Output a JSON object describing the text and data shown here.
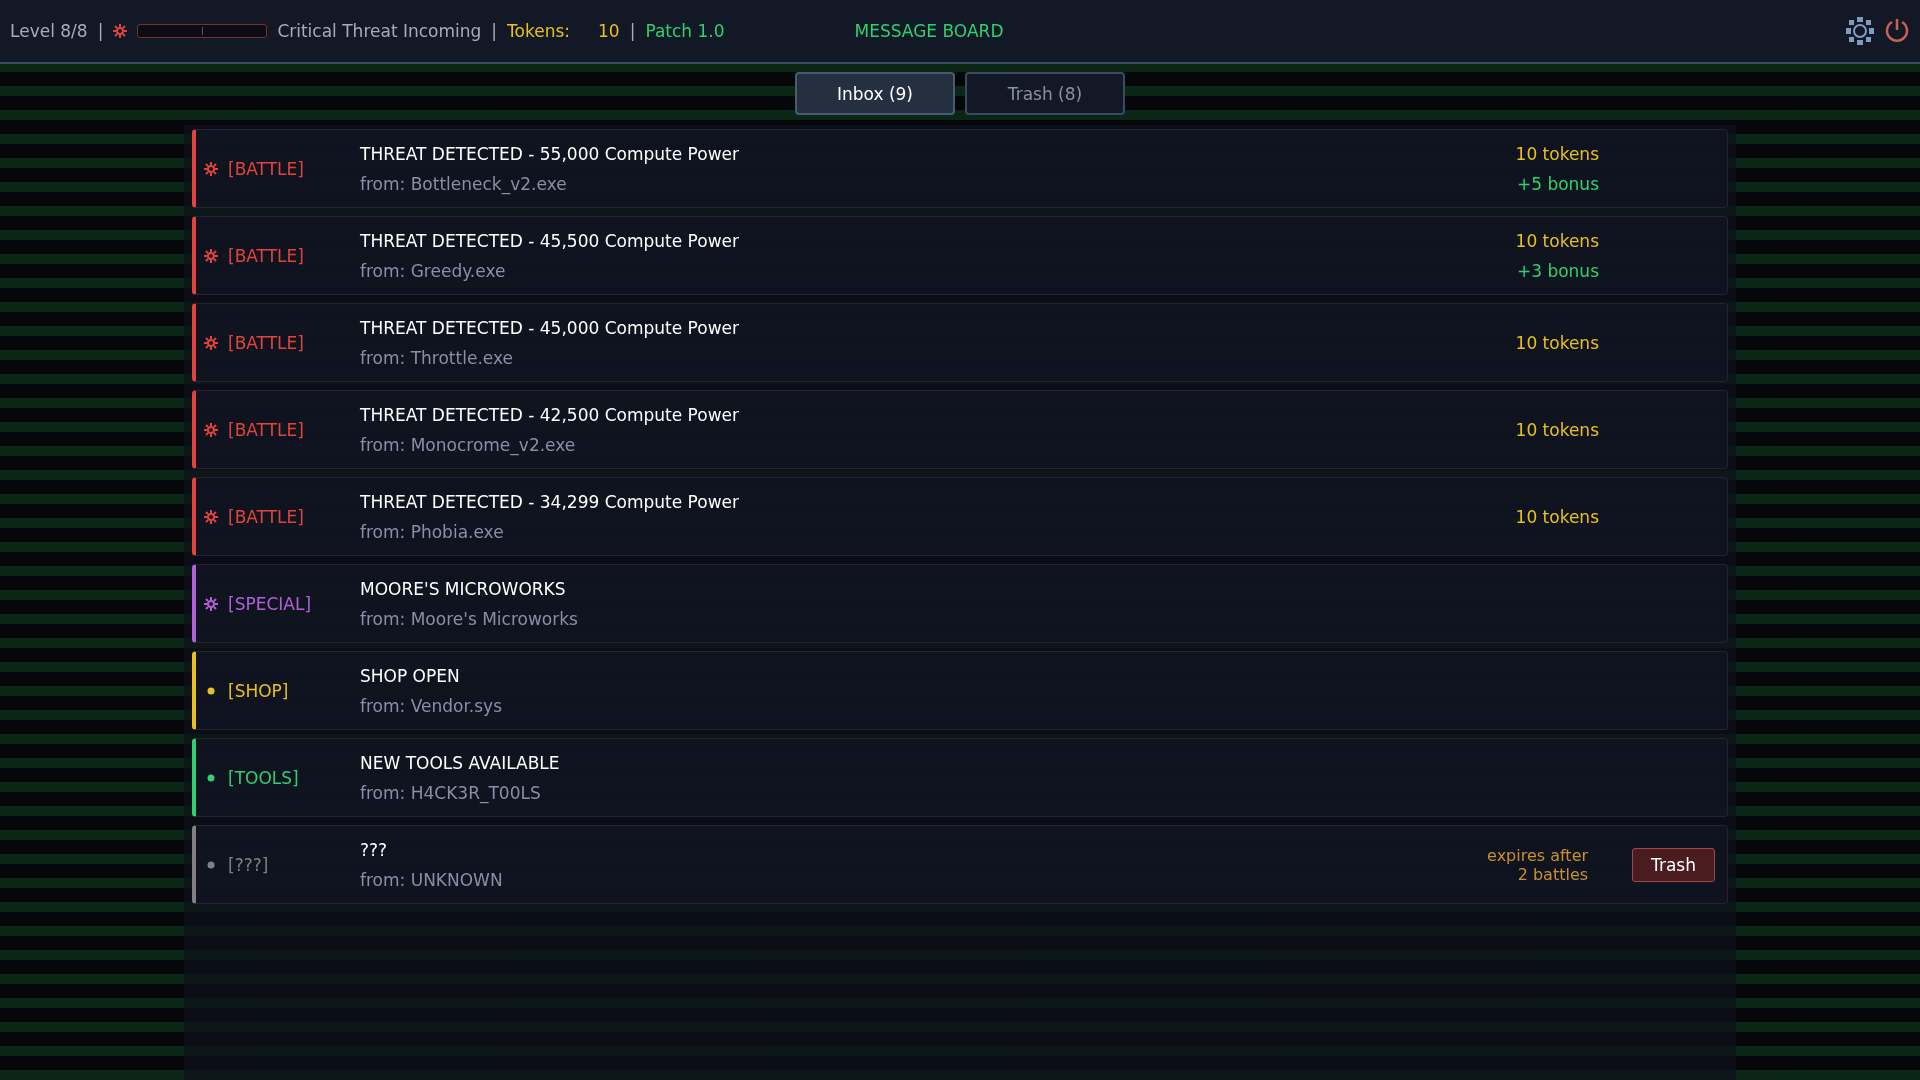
{
  "top_bar": {
    "level": "Level 8/8",
    "threat_meter": {
      "level": 0
    },
    "threat_text": "Critical Threat Incoming",
    "separators": [
      "|",
      "|",
      "|"
    ],
    "tokens_label": "Tokens:",
    "tokens_value": "10",
    "patch": "Patch 1.0",
    "title": "MESSAGE BOARD"
  },
  "tabs": [
    {
      "label": "Inbox (9)",
      "selected": true
    },
    {
      "label": "Trash (8)",
      "selected": false
    }
  ],
  "messages": [
    {
      "kind": "battle",
      "tag": "[BATTLE]",
      "title": "THREAT DETECTED - 55,000 Compute Power",
      "from": "from: Bottleneck_v2.exe",
      "reward": "10 tokens",
      "bonus": "+5 bonus"
    },
    {
      "kind": "battle",
      "tag": "[BATTLE]",
      "title": "THREAT DETECTED - 45,500 Compute Power",
      "from": "from: Greedy.exe",
      "reward": "10 tokens",
      "bonus": "+3 bonus"
    },
    {
      "kind": "battle",
      "tag": "[BATTLE]",
      "title": "THREAT DETECTED - 45,000 Compute Power",
      "from": "from: Throttle.exe",
      "reward": "10 tokens"
    },
    {
      "kind": "battle",
      "tag": "[BATTLE]",
      "title": "THREAT DETECTED - 42,500 Compute Power",
      "from": "from: Monocrome_v2.exe",
      "reward": "10 tokens"
    },
    {
      "kind": "battle",
      "tag": "[BATTLE]",
      "title": "THREAT DETECTED - 34,299 Compute Power",
      "from": "from: Phobia.exe",
      "reward": "10 tokens"
    },
    {
      "kind": "special",
      "tag": "[SPECIAL]",
      "title": "MOORE'S MICROWORKS",
      "from": "from: Moore's Microworks"
    },
    {
      "kind": "shop",
      "tag": "[SHOP]",
      "title": "SHOP OPEN",
      "from": "from: Vendor.sys"
    },
    {
      "kind": "tools",
      "tag": "[TOOLS]",
      "title": "NEW TOOLS AVAILABLE",
      "from": "from: H4CK3R_T00LS"
    },
    {
      "kind": "unknown",
      "tag": "[???]",
      "title": "???",
      "from": "from: UNKNOWN",
      "expires": [
        "expires after",
        "2 battles"
      ],
      "action": "Trash"
    }
  ]
}
